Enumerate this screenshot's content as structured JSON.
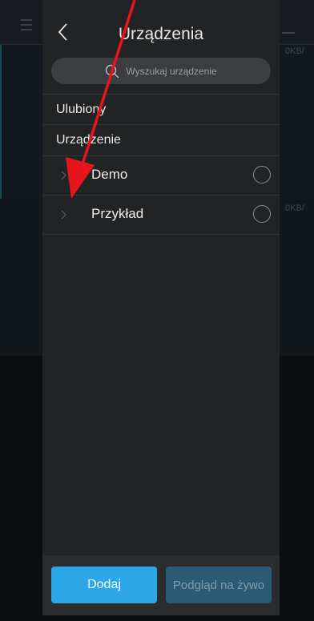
{
  "drawer": {
    "title": "Urządzenia",
    "search_placeholder": "Wyszukaj urządzenie",
    "sections": {
      "favorites": "Ulubiony",
      "devices": "Urządzenie"
    },
    "devices": [
      {
        "name": "Demo",
        "selected": false
      },
      {
        "name": "Przykład",
        "selected": false
      }
    ],
    "buttons": {
      "add": "Dodaj",
      "live_view": "Podgląd na żywo"
    }
  },
  "background": {
    "speed_1": "0KB/",
    "speed_2": "0KB/"
  },
  "colors": {
    "accent": "#2ba7e8",
    "disabled_button": "#2b5b74",
    "annotation_arrow": "#e8141c"
  }
}
